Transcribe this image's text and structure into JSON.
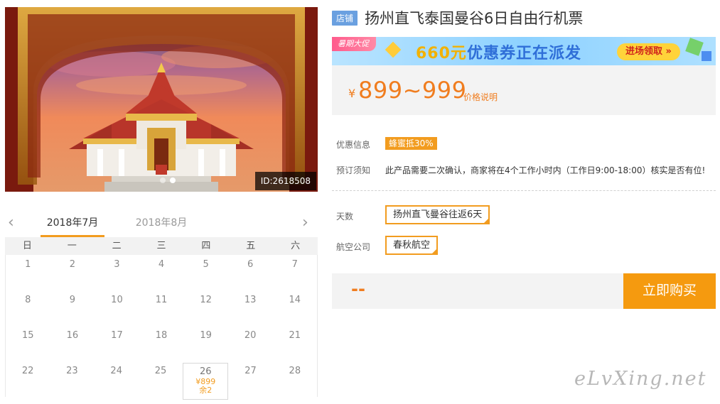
{
  "hero": {
    "id_label": "ID:2618508",
    "dots": 2,
    "active_dot": 1
  },
  "calendar": {
    "prev_icon": "chevron-left-icon",
    "next_icon": "chevron-right-icon",
    "months": [
      "2018年7月",
      "2018年8月"
    ],
    "active_month": 0,
    "weekdays": [
      "日",
      "一",
      "二",
      "三",
      "四",
      "五",
      "六"
    ],
    "rows": [
      [
        {
          "d": "1"
        },
        {
          "d": "2"
        },
        {
          "d": "3"
        },
        {
          "d": "4"
        },
        {
          "d": "5"
        },
        {
          "d": "6"
        },
        {
          "d": "7"
        }
      ],
      [
        {
          "d": "8"
        },
        {
          "d": "9"
        },
        {
          "d": "10"
        },
        {
          "d": "11"
        },
        {
          "d": "12"
        },
        {
          "d": "13"
        },
        {
          "d": "14"
        }
      ],
      [
        {
          "d": "15"
        },
        {
          "d": "16"
        },
        {
          "d": "17"
        },
        {
          "d": "18"
        },
        {
          "d": "19"
        },
        {
          "d": "20"
        },
        {
          "d": "21"
        }
      ],
      [
        {
          "d": "22"
        },
        {
          "d": "23"
        },
        {
          "d": "24"
        },
        {
          "d": "25"
        },
        {
          "d": "26",
          "price": "¥899",
          "left": "余2"
        },
        {
          "d": "27"
        },
        {
          "d": "28"
        }
      ]
    ]
  },
  "product": {
    "shop_tag": "店铺",
    "title": "扬州直飞泰国曼谷6日自由行机票"
  },
  "banner": {
    "promo_tag": "暑期大促",
    "amount": "660元",
    "text": "优惠券正在派发",
    "button": "进场领取 »"
  },
  "price": {
    "currency": "¥",
    "range": "899~999",
    "note": "价格说明"
  },
  "info": {
    "discount_label": "优惠信息",
    "discount_badge": "蜂蜜抵30%",
    "booking_label": "预订须知",
    "booking_text": "此产品需要二次确认，商家将在4个工作小时内（工作日9:00-18:00）核实是否有位!"
  },
  "options": {
    "days_label": "天数",
    "days_value": "扬州直飞曼谷往返6天",
    "airline_label": "航空公司",
    "airline_value": "春秋航空"
  },
  "buy": {
    "total": "--",
    "button": "立即购买"
  },
  "watermark": "eLvXing.net",
  "colors": {
    "accent": "#f29c1f",
    "price": "#f07d1f",
    "shop_tag": "#6aa0e0"
  }
}
